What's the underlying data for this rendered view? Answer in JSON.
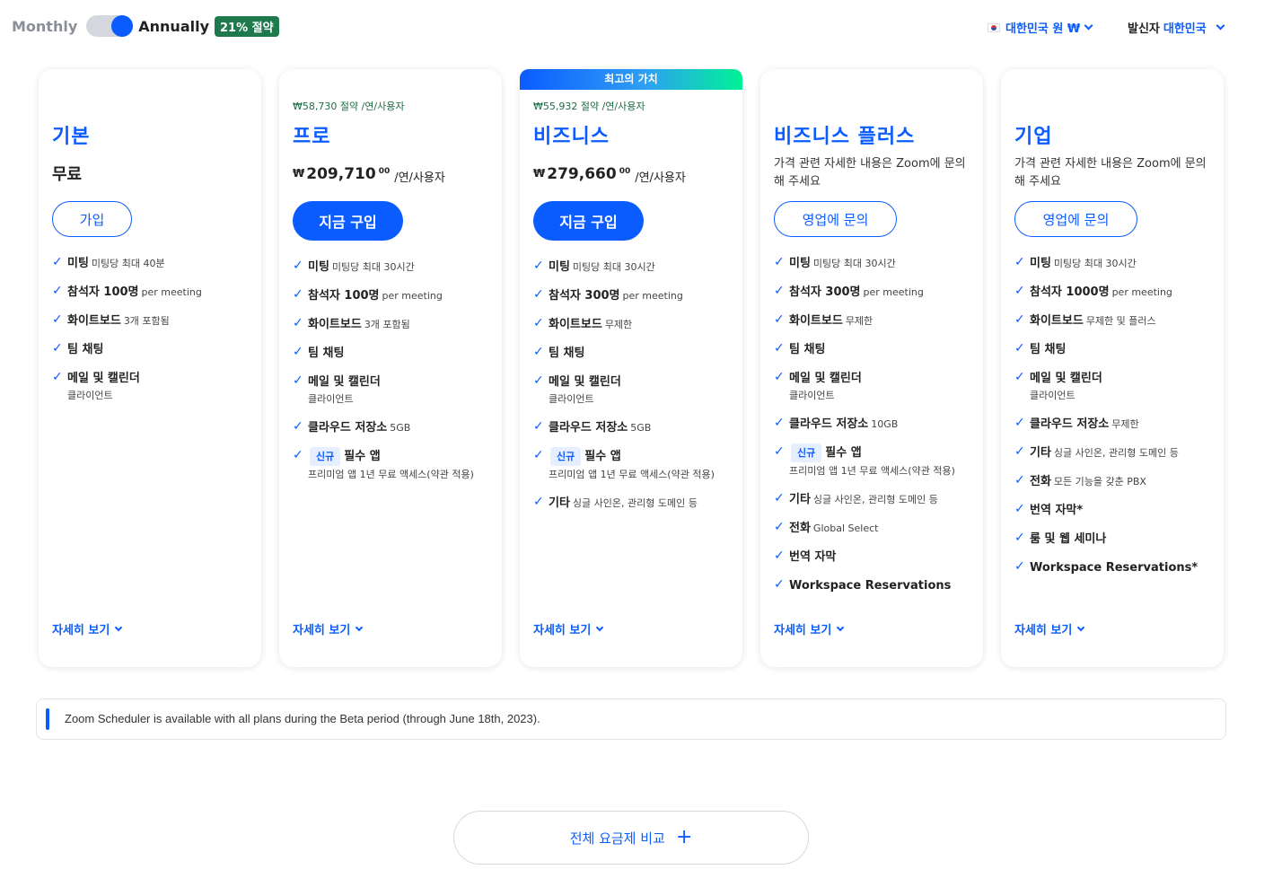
{
  "billing": {
    "monthly": "Monthly",
    "annually": "Annually",
    "save_badge": "21% 절약"
  },
  "currency": {
    "label": "대한민국 원 ₩"
  },
  "sender": {
    "label": "발신자",
    "value": "대한민국"
  },
  "cards": [
    {
      "name": "기본",
      "price_text": "무료",
      "button": "가입",
      "features": [
        {
          "title": "미팅",
          "desc": "미팅당 최대 40분"
        },
        {
          "title": "참석자 100명",
          "desc": "per meeting"
        },
        {
          "title": "화이트보드",
          "desc": "3개 포함됨"
        },
        {
          "title": "팀 채팅"
        },
        {
          "title": "메일 및 캘린더",
          "sub": "클라이언트"
        }
      ],
      "more": "자세히 보기"
    },
    {
      "saving": "₩58,730 절약 /연/사용자",
      "name": "프로",
      "price": {
        "currency": "₩",
        "amount": "209,710",
        "decimal": "00",
        "per": "/연/사용자"
      },
      "button": "지금 구입",
      "features": [
        {
          "title": "미팅",
          "desc": "미팅당 최대 30시간"
        },
        {
          "title": "참석자 100명",
          "desc": "per meeting"
        },
        {
          "title": "화이트보드",
          "desc": "3개 포함됨"
        },
        {
          "title": "팀 채팅"
        },
        {
          "title": "메일 및 캘린더",
          "sub": "클라이언트"
        },
        {
          "title": "클라우드 저장소",
          "desc": "5GB"
        },
        {
          "badge": "신규",
          "title": "필수 앱",
          "sub": "프리미엄 앱 1년 무료 액세스(약관 적용)"
        }
      ],
      "more": "자세히 보기"
    },
    {
      "ribbon": "최고의 가치",
      "saving": "₩55,932 절약 /연/사용자",
      "name": "비즈니스",
      "price": {
        "currency": "₩",
        "amount": "279,660",
        "decimal": "00",
        "per": "/연/사용자"
      },
      "button": "지금 구입",
      "features": [
        {
          "title": "미팅",
          "desc": "미팅당 최대 30시간"
        },
        {
          "title": "참석자 300명",
          "desc": "per meeting"
        },
        {
          "title": "화이트보드",
          "desc": "무제한"
        },
        {
          "title": "팀 채팅"
        },
        {
          "title": "메일 및 캘린더",
          "sub": "클라이언트"
        },
        {
          "title": "클라우드 저장소",
          "desc": "5GB"
        },
        {
          "badge": "신규",
          "title": "필수 앱",
          "sub": "프리미엄 앱 1년 무료 액세스(약관 적용)"
        },
        {
          "title": "기타",
          "desc": "싱글 사인온, 관리형 도메인 등"
        }
      ],
      "more": "자세히 보기"
    },
    {
      "name": "비즈니스 플러스",
      "note": "가격 관련 자세한 내용은 Zoom에 문의해 주세요",
      "button": "영업에 문의",
      "features": [
        {
          "title": "미팅",
          "desc": "미팅당 최대 30시간"
        },
        {
          "title": "참석자 300명",
          "desc": "per meeting"
        },
        {
          "title": "화이트보드",
          "desc": "무제한"
        },
        {
          "title": "팀 채팅"
        },
        {
          "title": "메일 및 캘린더",
          "sub": "클라이언트"
        },
        {
          "title": "클라우드 저장소",
          "desc": "10GB"
        },
        {
          "badge": "신규",
          "title": "필수 앱",
          "sub": "프리미엄 앱 1년 무료 액세스(약관 적용)"
        },
        {
          "title": "기타",
          "desc": "싱글 사인온, 관리형 도메인 등"
        },
        {
          "title": "전화",
          "desc": "Global Select"
        },
        {
          "title": "번역 자막"
        },
        {
          "title": "Workspace Reservations"
        }
      ],
      "more": "자세히 보기"
    },
    {
      "name": "기업",
      "note": "가격 관련 자세한 내용은 Zoom에 문의해 주세요",
      "button": "영업에 문의",
      "features": [
        {
          "title": "미팅",
          "desc": "미팅당 최대 30시간"
        },
        {
          "title": "참석자 1000명",
          "desc": "per meeting"
        },
        {
          "title": "화이트보드",
          "desc": "무제한 및 플러스"
        },
        {
          "title": "팀 채팅"
        },
        {
          "title": "메일 및 캘린더",
          "sub": "클라이언트"
        },
        {
          "title": "클라우드 저장소",
          "desc": "무제한"
        },
        {
          "title": "기타",
          "desc": "싱글 사인온, 관리형 도메인 등"
        },
        {
          "title": "전화",
          "desc": "모든 기능을 갖춘 PBX"
        },
        {
          "title": "번역 자막*"
        },
        {
          "title": "룸 및 웹 세미나"
        },
        {
          "title": "Workspace Reservations*"
        }
      ],
      "more": "자세히 보기"
    }
  ],
  "notice": "Zoom Scheduler is available with all plans during the Beta period (through June 18th, 2023).",
  "compare": {
    "label": "전체 요금제 비교",
    "icon": "plus-icon"
  },
  "colors": {
    "accent": "#0b5cff",
    "badge_green": "#1e7a4d",
    "ribbon_end": "#00f296"
  }
}
